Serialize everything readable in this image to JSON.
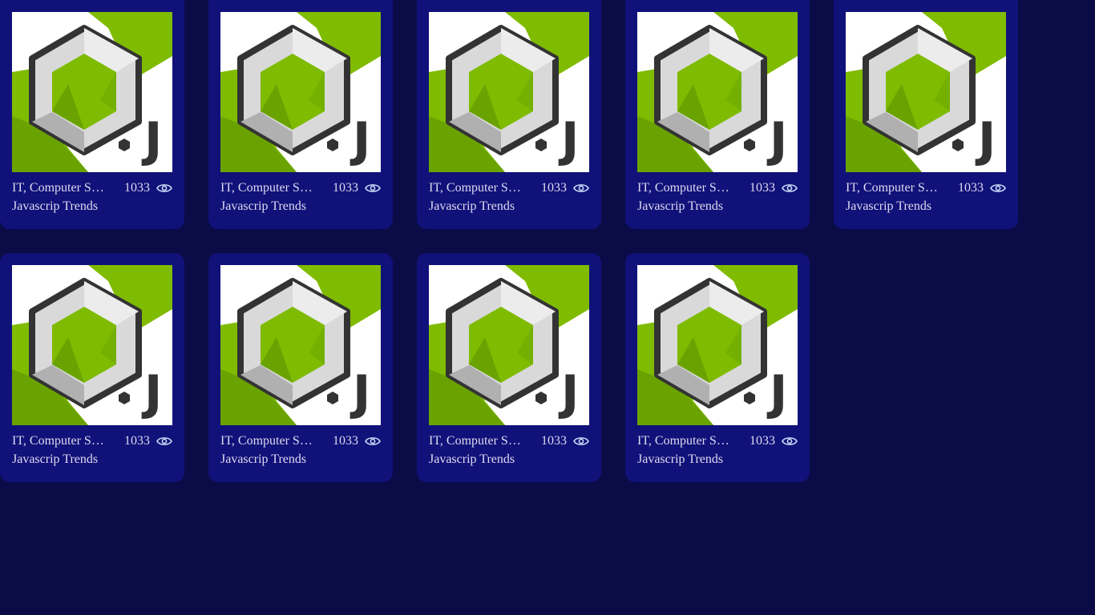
{
  "colors": {
    "page_background": "#0b0b47",
    "card_background": "#11117a",
    "text": "#dcdcf0",
    "logo_green": "#7fbb00",
    "logo_dark": "#333333"
  },
  "thumbnail": {
    "logo_letters": "J"
  },
  "cards": [
    {
      "category": "IT, Computer Science",
      "views": "1033",
      "title": "Javascrip Trends",
      "icon": "eye-icon"
    },
    {
      "category": "IT, Computer Science",
      "views": "1033",
      "title": "Javascrip Trends",
      "icon": "eye-icon"
    },
    {
      "category": "IT, Computer Science",
      "views": "1033",
      "title": "Javascrip Trends",
      "icon": "eye-icon"
    },
    {
      "category": "IT, Computer Science",
      "views": "1033",
      "title": "Javascrip Trends",
      "icon": "eye-icon"
    },
    {
      "category": "IT, Computer Science",
      "views": "1033",
      "title": "Javascrip Trends",
      "icon": "eye-icon"
    },
    {
      "category": "IT, Computer Science",
      "views": "1033",
      "title": "Javascrip Trends",
      "icon": "eye-icon"
    },
    {
      "category": "IT, Computer Science",
      "views": "1033",
      "title": "Javascrip Trends",
      "icon": "eye-icon"
    },
    {
      "category": "IT, Computer Science",
      "views": "1033",
      "title": "Javascrip Trends",
      "icon": "eye-icon"
    },
    {
      "category": "IT, Computer Science",
      "views": "1033",
      "title": "Javascrip Trends",
      "icon": "eye-icon"
    }
  ]
}
